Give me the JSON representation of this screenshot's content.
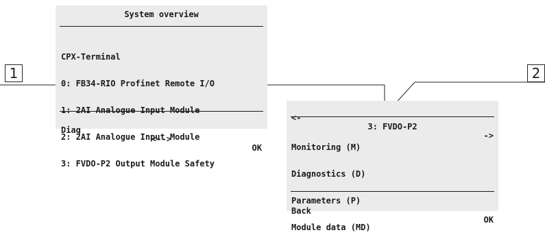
{
  "screen1": {
    "title": "System overview",
    "items": [
      "CPX-Terminal",
      "0: FB34-RIO Profinet Remote I/O",
      "1: 2AI Analogue Input Module",
      "2: 2AI Analogue Input Module",
      "3: FVDO-P2 Output Module Safety"
    ],
    "footer": {
      "left": "Diag",
      "center": "<-->",
      "right": "OK"
    }
  },
  "screen2": {
    "header": {
      "left": "<-",
      "center": "3: FVDO-P2",
      "right": "->"
    },
    "items": [
      "Monitoring (M)",
      "Diagnostics (D)",
      "Parameters (P)",
      "Module data (MD)"
    ],
    "footer": {
      "left": "Back",
      "right": "OK"
    }
  },
  "callouts": {
    "first": "1",
    "second": "2"
  },
  "colors": {
    "screen_bg": "#ebebeb",
    "text": "#1a1a1a",
    "line": "#222222"
  }
}
